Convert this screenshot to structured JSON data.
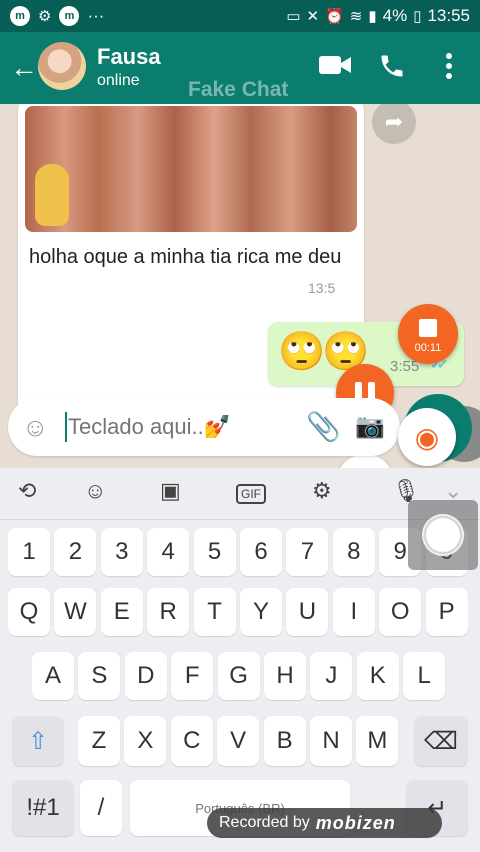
{
  "status_bar": {
    "time": "13:55",
    "battery": "4%",
    "badge_a": "m",
    "badge_b": "m",
    "more": "···"
  },
  "header": {
    "contact_name": "Fausa",
    "contact_status": "online",
    "watermark": "Fake Chat",
    "icons": [
      "back-arrow-icon",
      "video-call-icon",
      "phone-call-icon",
      "more-vert-icon"
    ]
  },
  "messages": [
    {
      "direction": "in",
      "type": "image-with-caption",
      "text": "holha oque a minha tia rica me deu",
      "time": "13:5"
    },
    {
      "direction": "out",
      "type": "emoji",
      "emojis": [
        "🙄",
        "🙄"
      ],
      "time": "3:55",
      "status": "read"
    }
  ],
  "recorder": {
    "elapsed": "00:11",
    "label": "Recorded by",
    "brand": "mobizen"
  },
  "composer": {
    "placeholder": "Teclado aqui..💅",
    "icons": [
      "emoji-icon",
      "attach-icon",
      "camera-icon"
    ]
  },
  "keyboard": {
    "toolbar": [
      "text-mode-icon",
      "emoji-icon",
      "sticker-icon",
      "gif-icon",
      "settings-icon",
      "mic-icon",
      "collapse-icon"
    ],
    "gif_label": "GIF",
    "row_numbers": [
      "1",
      "2",
      "3",
      "4",
      "5",
      "6",
      "7",
      "8",
      "9",
      "0"
    ],
    "row_top": [
      "Q",
      "W",
      "E",
      "R",
      "T",
      "Y",
      "U",
      "I",
      "O",
      "P"
    ],
    "row_middle": [
      "A",
      "S",
      "D",
      "F",
      "G",
      "H",
      "J",
      "K",
      "L"
    ],
    "row_bottom": [
      "Z",
      "X",
      "C",
      "V",
      "B",
      "N",
      "M"
    ],
    "symbols_key": "!#1",
    "slash_key": "/",
    "space_label": "Português (BR)"
  }
}
